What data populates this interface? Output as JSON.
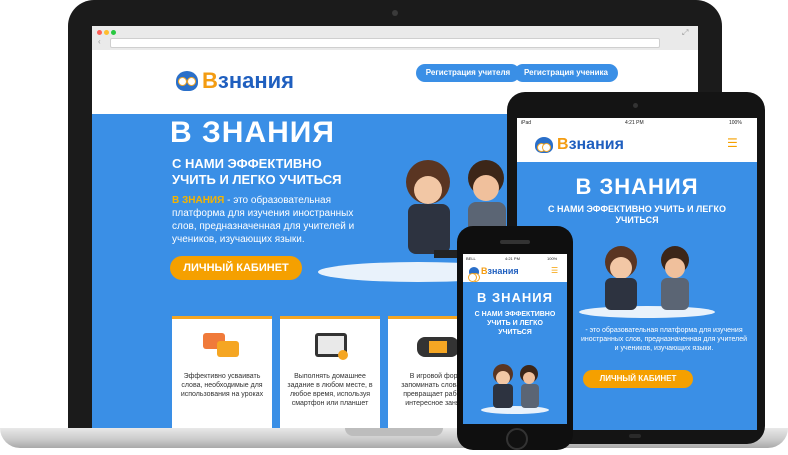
{
  "brand": {
    "logo_prefix": "В",
    "logo_text": "знания"
  },
  "laptop": {
    "nav": {
      "teacher_btn": "Регистрация учителя",
      "student_btn": "Регистрация ученика"
    },
    "hero": {
      "title": "В ЗНАНИЯ",
      "subtitle_line1": "С НАМИ ЭФФЕКТИВНО",
      "subtitle_line2": "УЧИТЬ И ЛЕГКО УЧИТЬСЯ",
      "body_accent": "В ЗНАНИЯ",
      "body_text": " - это образовательная платформа для изучения иностранных слов, предназначенная для учителей и учеников, изучающих языки.",
      "cta": "ЛИЧНЫЙ КАБИНЕТ"
    },
    "cards": [
      {
        "text": "Эффективно усваивать слова, необходимые для использования на уроках"
      },
      {
        "text": "Выполнять домашнее задание в любом месте, в любое время, используя смартфон или планшет"
      },
      {
        "text": "В игровой форме запоминать слова, что превращает работу в интересное занятие"
      }
    ]
  },
  "tablet": {
    "status_left": "iPad",
    "status_time": "4:21 PM",
    "status_battery": "100%",
    "hero_title": "В ЗНАНИЯ",
    "subtitle": "С НАМИ ЭФФЕКТИВНО УЧИТЬ И ЛЕГКО УЧИТЬСЯ",
    "body_text": " - это образовательная платформа для изучения иностранных слов, предназначенная для учителей и учеников, изучающих языки.",
    "cta": "ЛИЧНЫЙ КАБИНЕТ",
    "menu_icon": "☰"
  },
  "phone": {
    "status_left": "BELL",
    "status_time": "4:21 PM",
    "status_battery": "100%",
    "hero_title": "В ЗНАНИЯ",
    "subtitle": "С НАМИ ЭФФЕКТИВНО УЧИТЬ И ЛЕГКО УЧИТЬСЯ",
    "menu_icon": "☰"
  },
  "colors": {
    "brand_blue": "#3a8fe6",
    "accent_orange": "#f5a000",
    "logo_blue": "#1f5fbf"
  }
}
